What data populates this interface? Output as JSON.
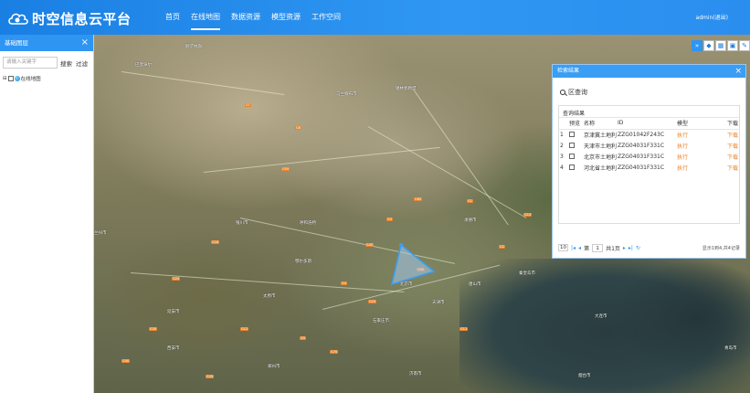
{
  "header": {
    "logo_text": "时空信息云平台",
    "nav": [
      {
        "label": "首页",
        "active": false
      },
      {
        "label": "在线地图",
        "active": true
      },
      {
        "label": "数据资源",
        "active": false
      },
      {
        "label": "模型资源",
        "active": false
      },
      {
        "label": "工作空间",
        "active": false
      }
    ],
    "user": "admin(退出)"
  },
  "left_panel": {
    "title": "基础图层",
    "close": "×",
    "search_placeholder": "请输入关键字",
    "search_button": "搜索",
    "filter_button": "过滤",
    "tree_toggle": "⊟",
    "tree_item": "在线地图"
  },
  "map": {
    "labels": [
      {
        "text": "额济纳旗"
      },
      {
        "text": "巴彦淖尔"
      },
      {
        "text": "乌兰察布市"
      },
      {
        "text": "锡林郭勒盟"
      },
      {
        "text": "承德市"
      },
      {
        "text": "兰州市"
      },
      {
        "text": "银川市"
      },
      {
        "text": "呼和浩特"
      },
      {
        "text": "鄂尔多斯"
      },
      {
        "text": "太原市"
      },
      {
        "text": "石家庄市"
      },
      {
        "text": "北京市"
      },
      {
        "text": "天津市"
      },
      {
        "text": "唐山市"
      },
      {
        "text": "秦皇岛市"
      },
      {
        "text": "大连市"
      },
      {
        "text": "济南市"
      },
      {
        "text": "郑州市"
      },
      {
        "text": "延安市"
      },
      {
        "text": "西安市"
      },
      {
        "text": "营口市"
      },
      {
        "text": "丹东市"
      },
      {
        "text": "烟台市"
      },
      {
        "text": "青岛市"
      }
    ],
    "shields": [
      "G7",
      "G6",
      "G55",
      "G65",
      "G45",
      "G4",
      "G1",
      "G2",
      "G3",
      "G18",
      "G20",
      "G30",
      "G70",
      "G5",
      "G25",
      "G15",
      "G95",
      "G11",
      "G12",
      "G35",
      "G40"
    ]
  },
  "toolbar": {
    "expand_icon": "»",
    "layers_icon": "◆",
    "chart_icon": "▦",
    "picture_icon": "▣",
    "pen_icon": "✎"
  },
  "query_window": {
    "title": "检索结果",
    "close": "×",
    "area_label": "区查询",
    "result_title": "查询结果",
    "columns": [
      "预览",
      "名称",
      "ID",
      "模型",
      "下载"
    ],
    "rows": [
      {
        "no": "1",
        "name": "京津冀土地利用基",
        "id": "ZZG01042F243C",
        "model": "执行",
        "download": "下载"
      },
      {
        "no": "2",
        "name": "天津市土地利用基",
        "id": "ZZG04031F331C",
        "model": "执行",
        "download": "下载"
      },
      {
        "no": "3",
        "name": "北京市土地利用基",
        "id": "ZZG04031F331C",
        "model": "执行",
        "download": "下载"
      },
      {
        "no": "4",
        "name": "河北省土地利用基",
        "id": "ZZG04031F331C",
        "model": "执行",
        "download": "下载"
      }
    ],
    "pager": {
      "page_size": "10",
      "page_prefix": "第",
      "page": "1",
      "total_pages": "共1页",
      "info": "显示1到4,共4记录"
    }
  }
}
